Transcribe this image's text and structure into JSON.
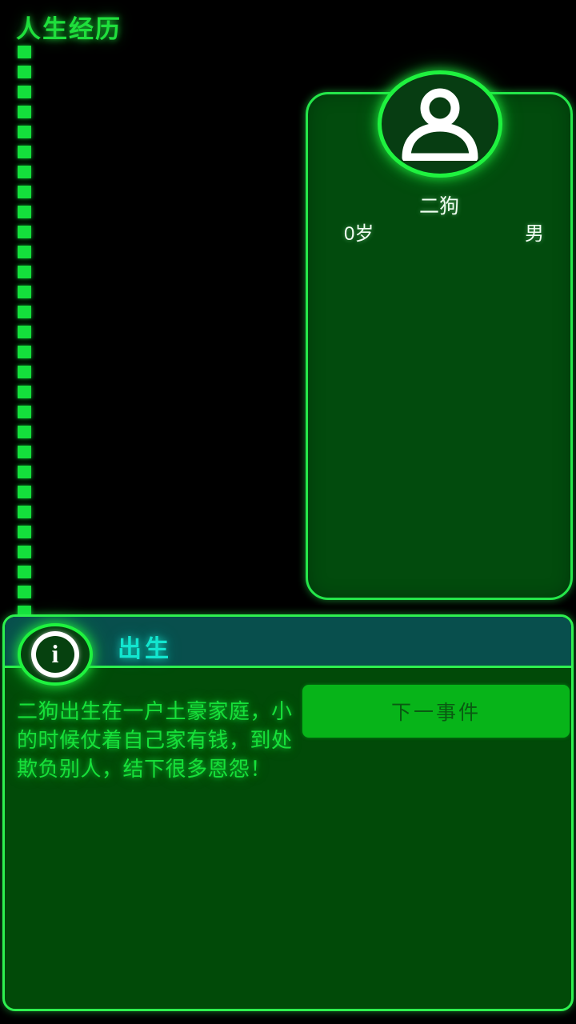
{
  "page": {
    "title": "人生经历"
  },
  "timeline": {
    "dash_count": 29
  },
  "profile": {
    "avatar_icon": "person-icon",
    "name": "二狗",
    "age": "0岁",
    "gender": "男"
  },
  "event": {
    "info_icon": "info-icon",
    "info_glyph": "i",
    "title": "出生",
    "description": "二狗出生在一户土豪家庭，小的时候仗着自己家有钱，到处欺负别人，结下很多恩怨！",
    "next_button_label": "下一事件"
  },
  "colors": {
    "background": "#000000",
    "neon_green": "#1fdf3c",
    "card_fill": "#024b0d",
    "panel_fill": "#014a08",
    "header_fill": "#084f4d",
    "title_cyan": "#12e6cf",
    "button_green": "#07b419",
    "button_text": "#0a5a12",
    "text_white": "#f0fff2"
  }
}
